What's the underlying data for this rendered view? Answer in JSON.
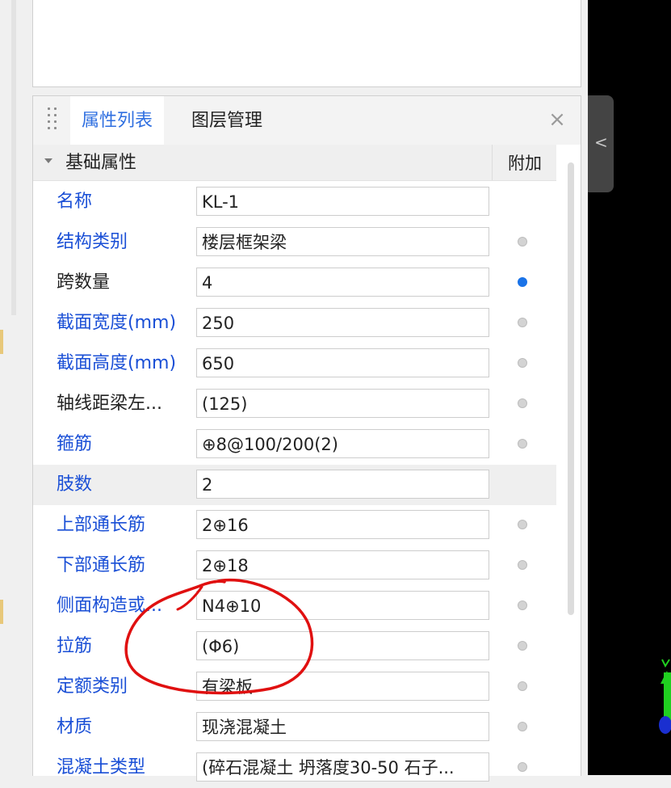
{
  "tabs": [
    {
      "label": "属性列表",
      "active": true
    },
    {
      "label": "图层管理",
      "active": false
    }
  ],
  "close_symbol": "×",
  "collapse_symbol": "<",
  "section": {
    "title": "基础属性",
    "extra_header": "附加"
  },
  "properties": [
    {
      "name": "名称",
      "value": "KL-1",
      "name_color": "blue",
      "dot": "none"
    },
    {
      "name": "结构类别",
      "value": "楼层框架梁",
      "name_color": "blue",
      "dot": "off"
    },
    {
      "name": "跨数量",
      "value": "4",
      "name_color": "black",
      "dot": "on"
    },
    {
      "name": "截面宽度(mm)",
      "value": "250",
      "name_color": "blue",
      "dot": "off"
    },
    {
      "name": "截面高度(mm)",
      "value": "650",
      "name_color": "blue",
      "dot": "off"
    },
    {
      "name": "轴线距梁左...",
      "value": "(125)",
      "name_color": "black",
      "dot": "off"
    },
    {
      "name": "箍筋",
      "value": "⊕8@100/200(2)",
      "name_color": "blue",
      "dot": "off"
    },
    {
      "name": "肢数",
      "value": "2",
      "name_color": "blue",
      "dot": "none",
      "highlight": true
    },
    {
      "name": "上部通长筋",
      "value": "2⊕16",
      "name_color": "blue",
      "dot": "off"
    },
    {
      "name": "下部通长筋",
      "value": "2⊕18",
      "name_color": "blue",
      "dot": "off"
    },
    {
      "name": "侧面构造或...",
      "value": "N4⊕10",
      "name_color": "blue",
      "dot": "off"
    },
    {
      "name": "拉筋",
      "value": "(Φ6)",
      "name_color": "blue",
      "dot": "off"
    },
    {
      "name": "定额类别",
      "value": "有梁板",
      "name_color": "blue",
      "dot": "off"
    },
    {
      "name": "材质",
      "value": "现浇混凝土",
      "name_color": "blue",
      "dot": "off"
    },
    {
      "name": "混凝土类型",
      "value": "(碎石混凝土 坍落度30-50 石子...",
      "name_color": "blue",
      "dot": "off"
    }
  ],
  "colors": {
    "tab_active": "#2f6fe0",
    "name_blue": "#1a4fd6",
    "dot_on": "#1a73e8",
    "annotation": "#e01010"
  },
  "icons": [
    "drag-handle-icon",
    "close-icon",
    "caret-down-icon",
    "chevron-left-icon"
  ]
}
